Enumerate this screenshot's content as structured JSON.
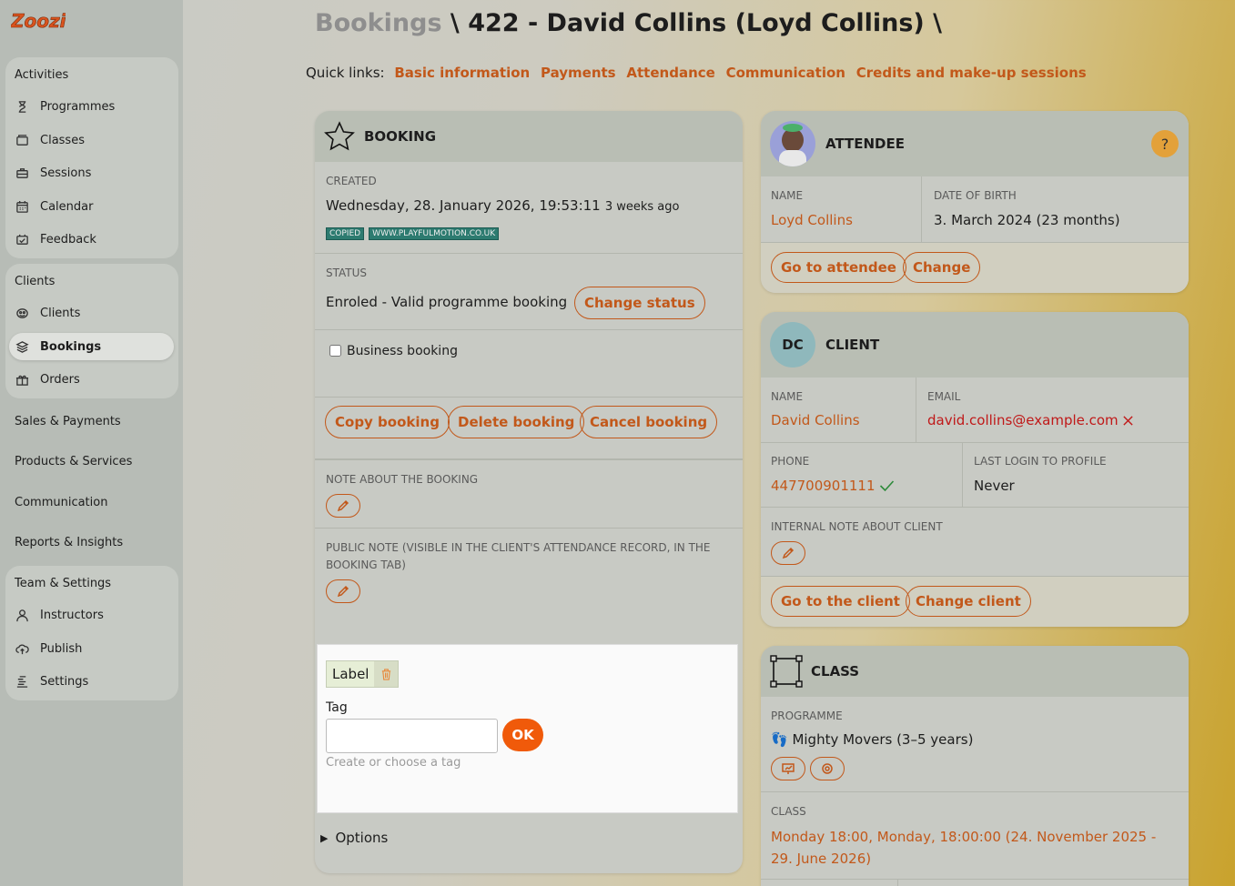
{
  "app": {
    "logo_text": "Zoozi"
  },
  "sidebar": {
    "activities": {
      "label": "Activities",
      "items": [
        {
          "label": "Programmes",
          "icon": "hourglass-icon"
        },
        {
          "label": "Classes",
          "icon": "folder-icon"
        },
        {
          "label": "Sessions",
          "icon": "briefcase-icon"
        },
        {
          "label": "Calendar",
          "icon": "calendar-icon"
        },
        {
          "label": "Feedback",
          "icon": "feedback-icon"
        }
      ]
    },
    "clients": {
      "label": "Clients",
      "items": [
        {
          "label": "Clients",
          "icon": "clients-icon"
        },
        {
          "label": "Bookings",
          "icon": "layers-icon",
          "active": true
        },
        {
          "label": "Orders",
          "icon": "gift-icon"
        }
      ]
    },
    "sales": {
      "label": "Sales & Payments"
    },
    "products": {
      "label": "Products & Services"
    },
    "communication": {
      "label": "Communication"
    },
    "reports": {
      "label": "Reports & Insights"
    },
    "team": {
      "label": "Team & Settings",
      "items": [
        {
          "label": "Instructors",
          "icon": "user-icon"
        },
        {
          "label": "Publish",
          "icon": "cloud-upload-icon"
        },
        {
          "label": "Settings",
          "icon": "settings-icon"
        }
      ]
    }
  },
  "header": {
    "root": "Bookings",
    "sep": " \\ ",
    "title": "422 - David Collins (Loyd Collins)",
    "trail": " \\",
    "quick_links_label": "Quick links:",
    "quick_links": [
      "Basic information",
      "Payments",
      "Attendance",
      "Communication",
      "Credits and make-up sessions"
    ]
  },
  "booking": {
    "title": "BOOKING",
    "created_label": "CREATED",
    "created_value": "Wednesday, 28. January 2026, 19:53:11",
    "created_ago": "3 weeks ago",
    "badges": [
      "COPIED",
      "WWW.PLAYFULMOTION.CO.UK"
    ],
    "status_label": "STATUS",
    "status_value": "Enroled - Valid programme booking",
    "change_status": "Change status",
    "business_booking": "Business booking",
    "copy": "Copy booking",
    "delete": "Delete booking",
    "cancel": "Cancel booking",
    "note_label": "NOTE ABOUT THE BOOKING",
    "public_note_label": "PUBLIC NOTE (VISIBLE IN THE CLIENT'S ATTENDANCE RECORD, IN THE BOOKING TAB)",
    "label_chip": "Label",
    "tag_label": "Tag",
    "tag_value": "",
    "tag_placeholder": "",
    "ok": "OK",
    "tag_hint": "Create or choose a tag",
    "options": "Options"
  },
  "attendee": {
    "title": "ATTENDEE",
    "help": "?",
    "name_label": "NAME",
    "name_value": "Loyd Collins",
    "dob_label": "DATE OF BIRTH",
    "dob_value": "3. March 2024 (23 months)",
    "go": "Go to attendee",
    "change": "Change"
  },
  "client": {
    "title": "CLIENT",
    "initials": "DC",
    "name_label": "NAME",
    "name_value": "David Collins",
    "email_label": "EMAIL",
    "email_value": "david.collins@example.com",
    "phone_label": "PHONE",
    "phone_value": "447700901111",
    "login_label": "LAST LOGIN TO PROFILE",
    "login_value": "Never",
    "internal_note_label": "INTERNAL NOTE ABOUT CLIENT",
    "go": "Go to the client",
    "change": "Change client"
  },
  "class": {
    "title": "CLASS",
    "programme_label": "PROGRAMME",
    "programme_value": "👣 Mighty Movers (3–5 years)",
    "class_label": "CLASS",
    "class_value": "Monday 18:00, Monday, 18:00:00 (24. November 2025 - 29. June 2026)"
  },
  "colors": {
    "accent": "#c2581a",
    "ok_button": "#f05a0a"
  }
}
